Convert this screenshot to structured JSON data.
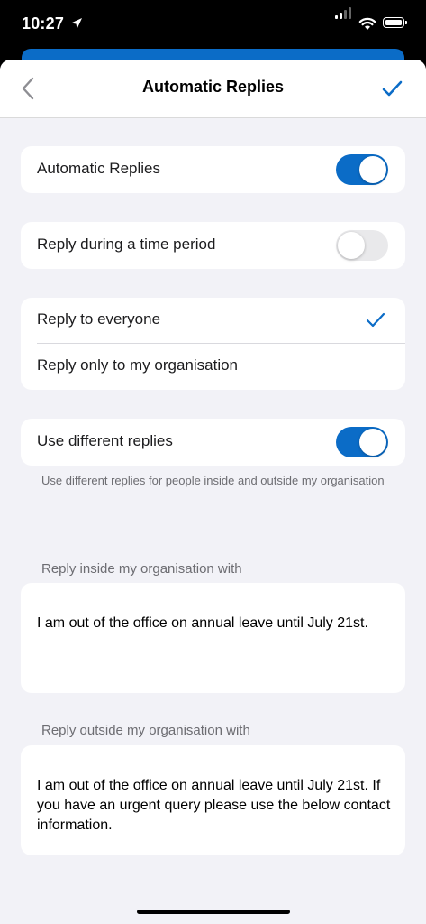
{
  "status_bar": {
    "time": "10:27",
    "icons": [
      "location-arrow-icon",
      "signal-icon",
      "wifi-icon",
      "battery-icon"
    ]
  },
  "colors": {
    "accent": "#0b6cc7",
    "background": "#f2f2f7",
    "toggle_off": "#e9e9eb",
    "secondary_text": "#6d6d72"
  },
  "nav": {
    "title": "Automatic Replies",
    "back_icon": "chevron-left-icon",
    "done_icon": "checkmark-icon"
  },
  "settings": {
    "automatic_replies": {
      "label": "Automatic Replies",
      "enabled": true
    },
    "time_period": {
      "label": "Reply during a time period",
      "enabled": false
    },
    "audience": {
      "options": [
        {
          "label": "Reply to everyone",
          "selected": true
        },
        {
          "label": "Reply only to my organisation",
          "selected": false
        }
      ]
    },
    "different_replies": {
      "label": "Use different replies",
      "enabled": true,
      "footnote": "Use different replies for people inside and outside my organisation"
    }
  },
  "replies": {
    "inside": {
      "header": "Reply inside my organisation with",
      "text": "I am out of the office on annual leave until July 21st."
    },
    "outside": {
      "header": "Reply outside my organisation with",
      "text": "I am out of the office on annual leave until July 21st.  If you have an urgent query please use the below contact information."
    }
  }
}
